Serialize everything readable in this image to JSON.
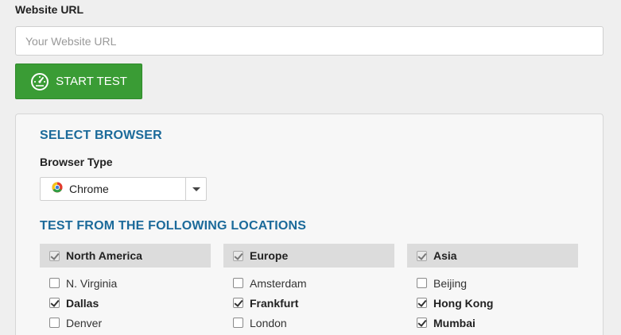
{
  "url_field": {
    "label": "Website URL",
    "placeholder": "Your Website URL",
    "value": ""
  },
  "start_button": {
    "label": "START TEST",
    "icon": "speedometer-icon",
    "color": "#3a9c35"
  },
  "browser_section": {
    "title": "SELECT BROWSER",
    "type_label": "Browser Type",
    "selected": "Chrome",
    "icon": "chrome-icon"
  },
  "locations": {
    "title": "TEST FROM THE FOLLOWING LOCATIONS",
    "regions": [
      {
        "name": "North America",
        "checked": true,
        "cities": [
          {
            "name": "N. Virginia",
            "checked": false
          },
          {
            "name": "Dallas",
            "checked": true
          },
          {
            "name": "Denver",
            "checked": false
          }
        ]
      },
      {
        "name": "Europe",
        "checked": true,
        "cities": [
          {
            "name": "Amsterdam",
            "checked": false
          },
          {
            "name": "Frankfurt",
            "checked": true
          },
          {
            "name": "London",
            "checked": false
          }
        ]
      },
      {
        "name": "Asia",
        "checked": true,
        "cities": [
          {
            "name": "Beijing",
            "checked": false
          },
          {
            "name": "Hong Kong",
            "checked": true
          },
          {
            "name": "Mumbai",
            "checked": true
          }
        ]
      }
    ]
  },
  "colors": {
    "section_title": "#1b6a9a",
    "button_green": "#3a9c35",
    "page_bg": "#efefef"
  }
}
